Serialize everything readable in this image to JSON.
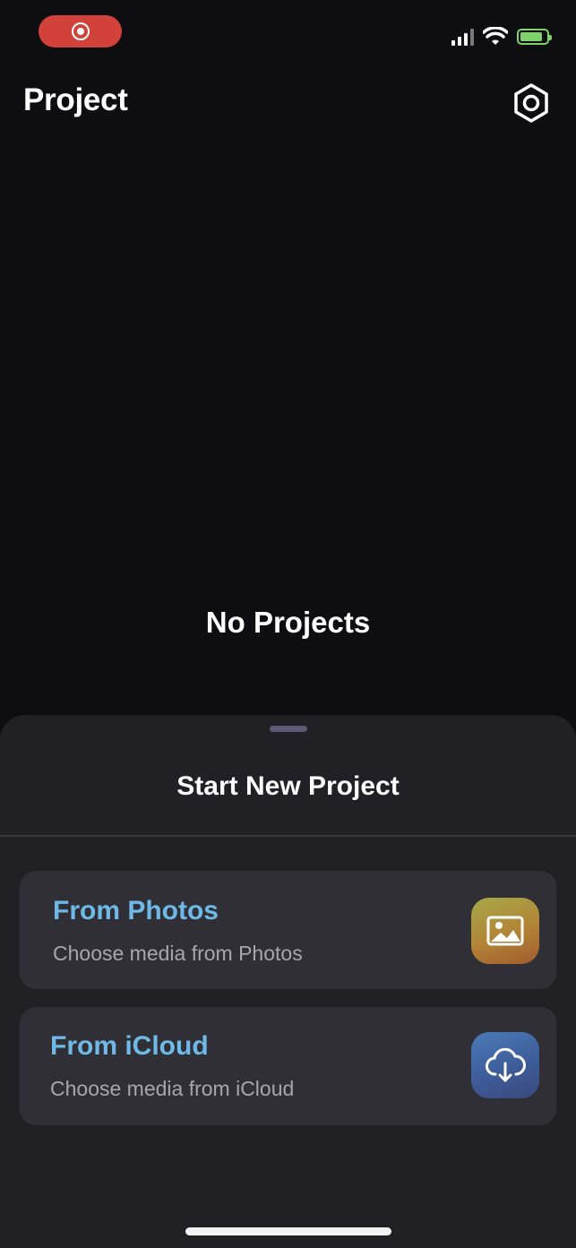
{
  "status_bar": {
    "recording_indicator": "screen-recording",
    "signal_icon": "cellular-signal-icon",
    "wifi_icon": "wifi-icon",
    "battery_icon": "battery-charging-icon",
    "battery_color": "#7fd36a",
    "battery_level": 0.85
  },
  "header": {
    "title": "Project",
    "settings_icon": "gear-icon"
  },
  "empty_state": {
    "message": "No Projects"
  },
  "sheet": {
    "title": "Start New Project",
    "options": [
      {
        "title": "From Photos",
        "subtitle": "Choose media from Photos",
        "icon": "photo-icon"
      },
      {
        "title": "From iCloud",
        "subtitle": "Choose media from iCloud",
        "icon": "cloud-download-icon"
      }
    ]
  },
  "colors": {
    "background": "#0e0d10",
    "sheet": "#212024",
    "card": "#302f35",
    "accent_text": "#6fb9e8",
    "recording_pill": "#d2423a"
  }
}
